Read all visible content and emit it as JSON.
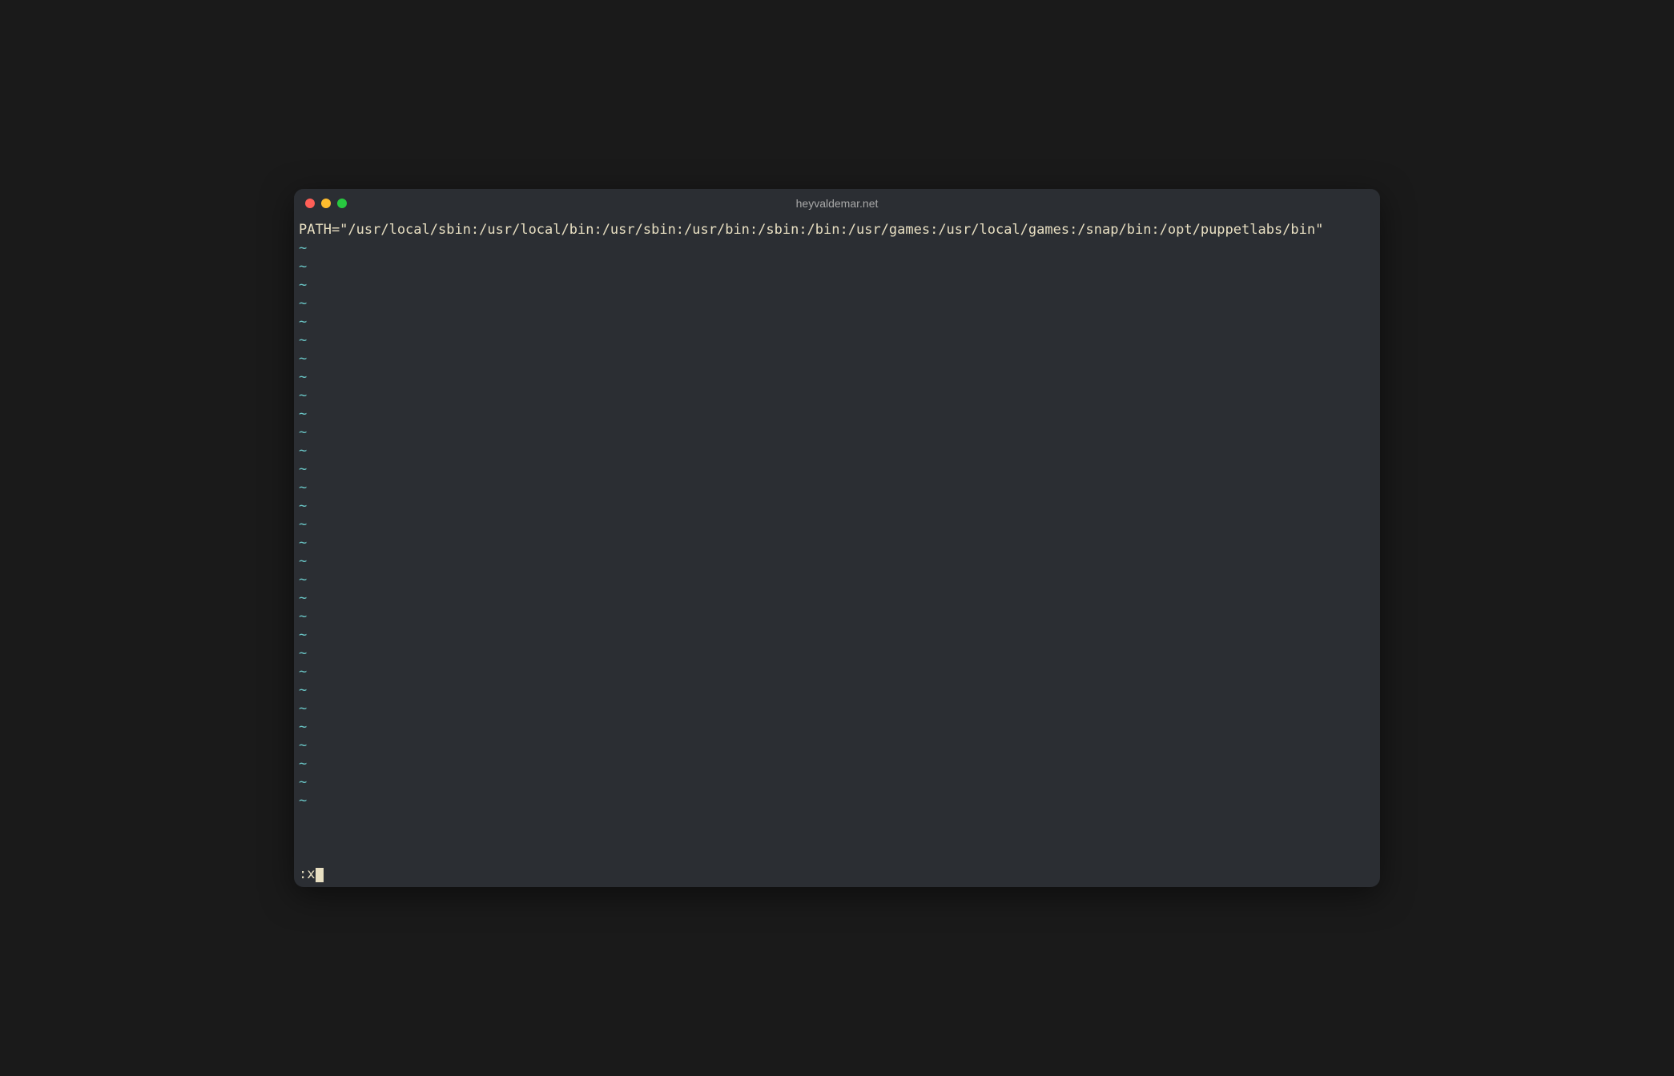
{
  "window": {
    "title": "heyvaldemar.net"
  },
  "editor": {
    "content": "PATH=\"/usr/local/sbin:/usr/local/bin:/usr/sbin:/usr/bin:/sbin:/bin:/usr/games:/usr/local/games:/snap/bin:/opt/puppetlabs/bin\"",
    "empty_line_marker": "~",
    "command": ":x",
    "tilde_count": 31
  },
  "colors": {
    "background": "#2b2e33",
    "text": "#e8dfc2",
    "tilde": "#6ac6c6",
    "close": "#ff5f57",
    "minimize": "#febc2e",
    "maximize": "#28c840"
  }
}
